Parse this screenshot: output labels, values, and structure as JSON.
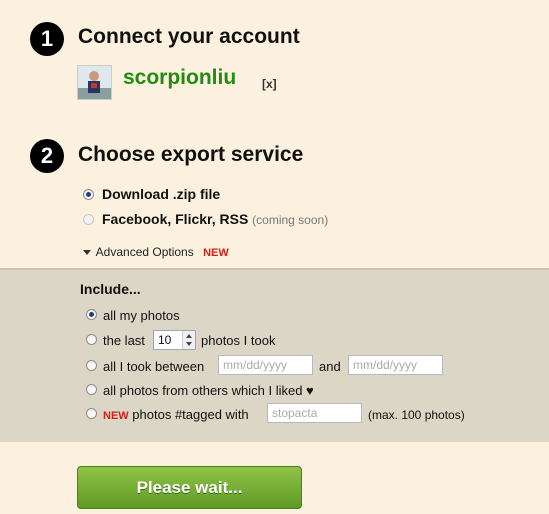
{
  "step1": {
    "number": "1",
    "title": "Connect your account"
  },
  "account": {
    "username": "scorpionliu",
    "remove_label": "[x]"
  },
  "step2": {
    "number": "2",
    "title": "Choose export service"
  },
  "services": [
    {
      "label": "Download .zip file",
      "note": "",
      "selected": true,
      "enabled": true
    },
    {
      "label": "Facebook, Flickr, RSS",
      "note": "(coming soon)",
      "selected": false,
      "enabled": false
    }
  ],
  "advanced": {
    "label": "Advanced Options",
    "badge": "NEW"
  },
  "include": {
    "title": "Include...",
    "all_photos": "all my photos",
    "last_prefix": "the last",
    "last_count": "10",
    "last_suffix": "photos I took",
    "between_prefix": "all I took between",
    "date_placeholder_1": "mm/dd/yyyy",
    "between_and": "and",
    "date_placeholder_2": "mm/dd/yyyy",
    "liked": "all photos from others which I liked ♥",
    "tagged_badge": "NEW",
    "tagged_label": "photos #tagged with",
    "tagged_placeholder": "stopacta",
    "tagged_note": "(max. 100 photos)",
    "selected_option": "all_photos"
  },
  "button": {
    "label": "Please wait..."
  },
  "colors": {
    "background": "#fbf1de",
    "panel": "#dcd6c7",
    "username": "#228b11",
    "new_badge": "#d0201a",
    "button": "#6fab31"
  },
  "icons": {
    "avatar": "user-avatar-image",
    "advanced_toggle": "triangle-down-icon",
    "liked": "heart-icon"
  }
}
